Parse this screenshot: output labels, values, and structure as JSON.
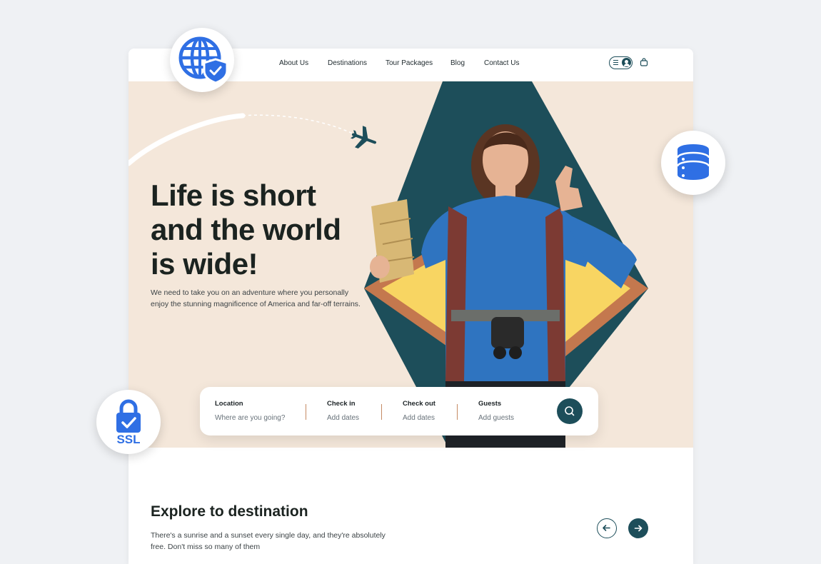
{
  "nav": {
    "links": [
      "About Us",
      "Destinations",
      "Tour Packages",
      "Blog",
      "Contact Us"
    ]
  },
  "icons": {
    "account_menu": "menu-icon",
    "account_user": "user-icon",
    "bag": "shopping-bag-icon",
    "search": "search-icon",
    "prev": "arrow-left-icon",
    "next": "arrow-right-icon",
    "globe_badge": "globe-shield-icon",
    "database_badge": "database-icon",
    "ssl_badge": "ssl-lock-icon"
  },
  "hero": {
    "headline": [
      "Life is short",
      "and the world",
      "is wide!"
    ],
    "subtext": "We need to take you on an adventure where you personally enjoy the stunning magnificence of America and far-off terrains."
  },
  "search": {
    "fields": [
      {
        "label": "Location",
        "value": "Where are you going?"
      },
      {
        "label": "Check in",
        "value": "Add dates"
      },
      {
        "label": "Check out",
        "value": "Add dates"
      },
      {
        "label": "Guests",
        "value": "Add guests"
      }
    ]
  },
  "explore": {
    "title": "Explore to destination",
    "text": "There's a sunrise and a sunset every single day, and they're absolutely free. Don't miss so many of them"
  },
  "badges": {
    "ssl_text": "SSL"
  },
  "colors": {
    "primary": "#1d4e5a",
    "hero_bg": "#f4e7da",
    "accent_orange": "#c4784e",
    "accent_yellow": "#f8d562",
    "badge_blue": "#2f6fe4",
    "page_bg": "#eff1f4"
  }
}
